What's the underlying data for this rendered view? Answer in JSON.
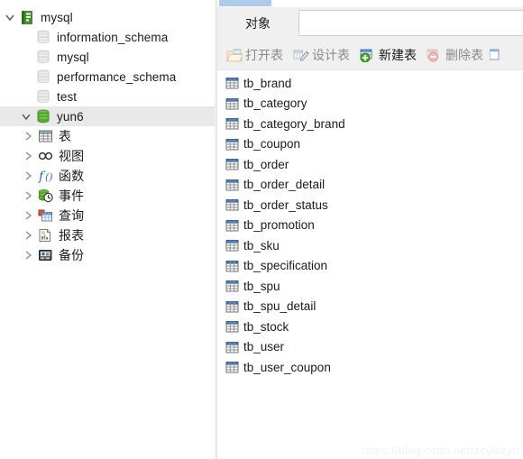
{
  "window": {
    "app": "Navicat",
    "watermark": "https://blog.csdn.net/zcylxzyh"
  },
  "tree": {
    "items": [
      {
        "label": "mysql",
        "icon": "server-icon",
        "level": 0,
        "twisty": "down",
        "selected": false,
        "state": "connected"
      },
      {
        "label": "information_schema",
        "icon": "database-icon",
        "level": 1,
        "twisty": "none",
        "selected": false,
        "state": "closed"
      },
      {
        "label": "mysql",
        "icon": "database-icon",
        "level": 1,
        "twisty": "none",
        "selected": false,
        "state": "closed"
      },
      {
        "label": "performance_schema",
        "icon": "database-icon",
        "level": 1,
        "twisty": "none",
        "selected": false,
        "state": "closed"
      },
      {
        "label": "test",
        "icon": "database-icon",
        "level": 1,
        "twisty": "none",
        "selected": false,
        "state": "closed"
      },
      {
        "label": "yun6",
        "icon": "database-open-icon",
        "level": 1,
        "twisty": "down",
        "selected": true,
        "state": "open"
      },
      {
        "label": "表",
        "icon": "table-icon",
        "level": 2,
        "twisty": "right",
        "selected": false,
        "state": "closed"
      },
      {
        "label": "视图",
        "icon": "view-icon",
        "level": 2,
        "twisty": "right",
        "selected": false,
        "state": "closed"
      },
      {
        "label": "函数",
        "icon": "function-icon",
        "level": 2,
        "twisty": "right",
        "selected": false,
        "state": "closed"
      },
      {
        "label": "事件",
        "icon": "event-icon",
        "level": 2,
        "twisty": "right",
        "selected": false,
        "state": "closed"
      },
      {
        "label": "查询",
        "icon": "query-icon",
        "level": 2,
        "twisty": "right",
        "selected": false,
        "state": "closed"
      },
      {
        "label": "报表",
        "icon": "report-icon",
        "level": 2,
        "twisty": "right",
        "selected": false,
        "state": "closed"
      },
      {
        "label": "备份",
        "icon": "backup-icon",
        "level": 2,
        "twisty": "right",
        "selected": false,
        "state": "closed"
      }
    ]
  },
  "tabs": {
    "active_label": "对象",
    "active_indicator_color": "#aecbeb"
  },
  "toolbar": {
    "buttons": [
      {
        "label": "打开表",
        "icon": "open-table-icon",
        "enabled": false
      },
      {
        "label": "设计表",
        "icon": "design-table-icon",
        "enabled": false
      },
      {
        "label": "新建表",
        "icon": "new-table-icon",
        "enabled": true
      },
      {
        "label": "删除表",
        "icon": "delete-table-icon",
        "enabled": false
      }
    ]
  },
  "table_list": {
    "icon": "table-grid-icon",
    "items": [
      "tb_brand",
      "tb_category",
      "tb_category_brand",
      "tb_coupon",
      "tb_order",
      "tb_order_detail",
      "tb_order_status",
      "tb_promotion",
      "tb_sku",
      "tb_specification",
      "tb_spu",
      "tb_spu_detail",
      "tb_stock",
      "tb_user",
      "tb_user_coupon"
    ]
  },
  "colors": {
    "accent_blue": "#aecbeb",
    "selection_gray": "#e9e9e9",
    "toolbar_bg": "#f0f0f0",
    "db_green": "#5aa832",
    "table_blue": "#4a7ebb"
  }
}
